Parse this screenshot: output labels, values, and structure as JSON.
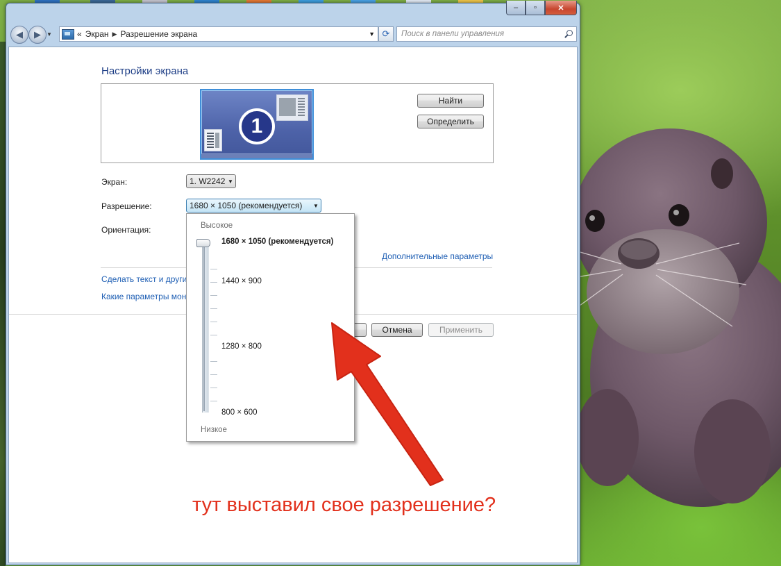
{
  "window": {
    "breadcrumbs": [
      "Экран",
      "Разрешение экрана"
    ],
    "crumb_prefix": "«",
    "search_placeholder": "Поиск в панели управления",
    "caption": {
      "min": "‒",
      "max": "▫",
      "close": "✕"
    }
  },
  "page": {
    "title": "Настройки экрана",
    "monitor_number": "1",
    "find_button": "Найти",
    "identify_button": "Определить",
    "screen_label": "Экран:",
    "screen_value": "1. W2242",
    "resolution_label": "Разрешение:",
    "resolution_value": "1680 × 1050 (рекомендуется)",
    "orientation_label": "Ориентация:",
    "advanced_link": "Дополнительные параметры",
    "text_size_link": "Сделать текст и други",
    "monitor_params_link": "Какие параметры мон",
    "cancel_button": "Отмена",
    "apply_button": "Применить"
  },
  "resolution_dropdown": {
    "high_label": "Высокое",
    "low_label": "Низкое",
    "options": [
      {
        "label": "1680 × 1050 (рекомендуется)",
        "selected": true
      },
      {
        "label": "1440 × 900",
        "selected": false
      },
      {
        "label": "1280 × 800",
        "selected": false
      },
      {
        "label": "800 × 600",
        "selected": false
      }
    ],
    "slider_level": 1.0
  },
  "annotation": {
    "text": "тут выставил свое разрешение?",
    "color": "#e2301c"
  },
  "colors": {
    "link": "#1f5fb4",
    "title": "#1e3e86",
    "accent": "#3f8fd9"
  }
}
